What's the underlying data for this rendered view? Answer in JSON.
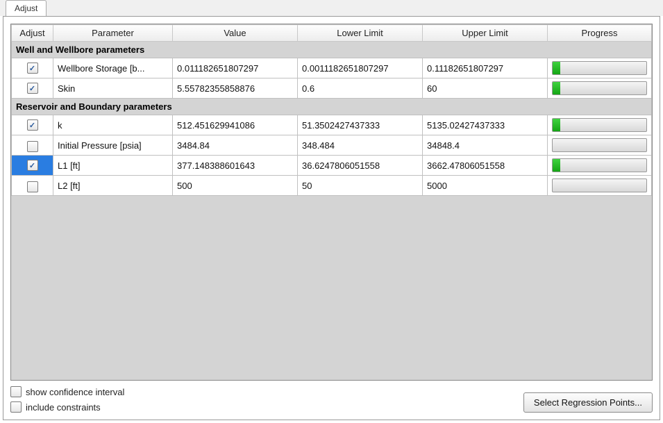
{
  "tab": {
    "label": "Adjust"
  },
  "columns": {
    "adjust": "Adjust",
    "parameter": "Parameter",
    "value": "Value",
    "lower": "Lower Limit",
    "upper": "Upper Limit",
    "progress": "Progress"
  },
  "groups": [
    {
      "title": "Well and Wellbore parameters",
      "rows": [
        {
          "adjust": true,
          "selected": false,
          "param": "Wellbore Storage [b...",
          "value": "0.011182651807297",
          "lower": "0.0011182651807297",
          "upper": "0.11182651807297",
          "progress": 8
        },
        {
          "adjust": true,
          "selected": false,
          "param": "Skin",
          "value": "5.55782355858876",
          "lower": "0.6",
          "upper": "60",
          "progress": 8
        }
      ]
    },
    {
      "title": "Reservoir and Boundary parameters",
      "rows": [
        {
          "adjust": true,
          "selected": false,
          "param": "k",
          "value": "512.451629941086",
          "lower": "51.3502427437333",
          "upper": "5135.02427437333",
          "progress": 8
        },
        {
          "adjust": false,
          "selected": false,
          "param": "Initial Pressure [psia]",
          "value": "3484.84",
          "lower": "348.484",
          "upper": "34848.4",
          "progress": 0
        },
        {
          "adjust": true,
          "selected": true,
          "param": "L1 [ft]",
          "value": "377.148388601643",
          "lower": "36.6247806051558",
          "upper": "3662.47806051558",
          "progress": 8
        },
        {
          "adjust": false,
          "selected": false,
          "param": "L2 [ft]",
          "value": "500",
          "lower": "50",
          "upper": "5000",
          "progress": 0
        }
      ]
    }
  ],
  "footer": {
    "show_conf": "show confidence interval",
    "include_constraints": "include constraints",
    "select_points": "Select Regression Points..."
  }
}
